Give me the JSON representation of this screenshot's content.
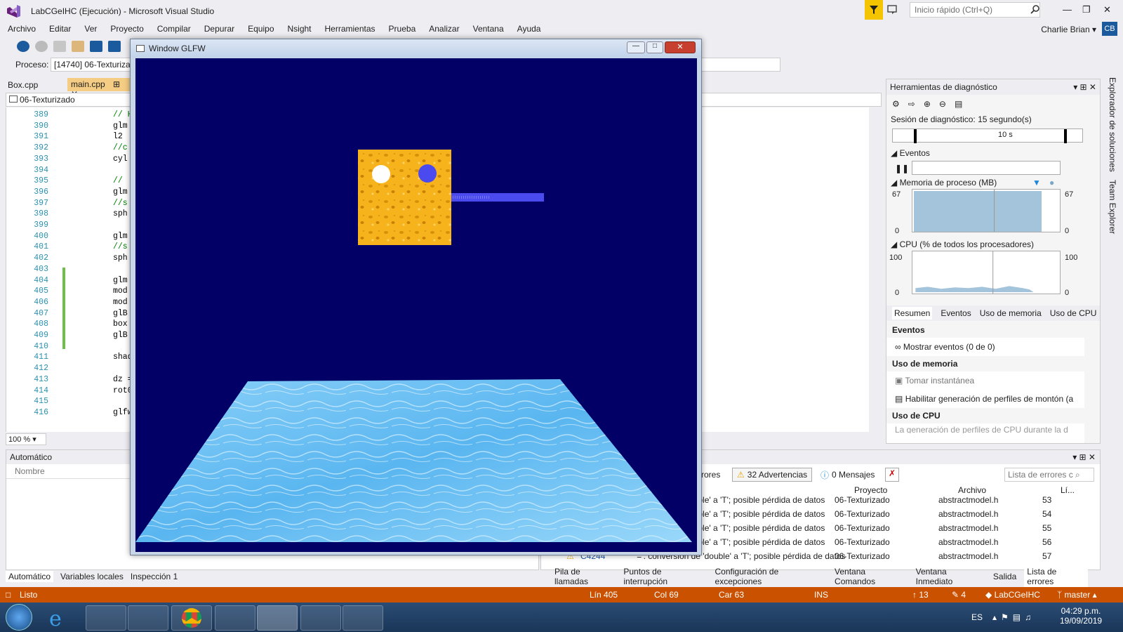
{
  "window": {
    "title": "LabCGeIHC (Ejecución) - Microsoft Visual Studio",
    "quick_launch_placeholder": "Inicio rápido (Ctrl+Q)"
  },
  "user": {
    "name": "Charlie Brian",
    "initials": "CB"
  },
  "menu": [
    "Archivo",
    "Editar",
    "Ver",
    "Proyecto",
    "Compilar",
    "Depurar",
    "Equipo",
    "Nsight",
    "Herramientas",
    "Prueba",
    "Analizar",
    "Ventana",
    "Ayuda"
  ],
  "toolbar": {
    "process_label": "Proceso:",
    "process_value": "[14740] 06-Texturiza"
  },
  "tabs": [
    {
      "label": "Box.cpp"
    },
    {
      "label": "main.cpp"
    }
  ],
  "editor": {
    "nav": "06-Texturizado",
    "zoom": "100 %",
    "lines": [
      {
        "n": "389",
        "t": "// H",
        "c": true
      },
      {
        "n": "390",
        "t": "glm"
      },
      {
        "n": "391",
        "t": "l2"
      },
      {
        "n": "392",
        "t": "//c",
        "c": true
      },
      {
        "n": "393",
        "t": "cyl"
      },
      {
        "n": "394",
        "t": ""
      },
      {
        "n": "395",
        "t": "//",
        "c": true
      },
      {
        "n": "396",
        "t": "glm"
      },
      {
        "n": "397",
        "t": "//s",
        "c": true
      },
      {
        "n": "398",
        "t": "sph"
      },
      {
        "n": "399",
        "t": ""
      },
      {
        "n": "400",
        "t": "glm"
      },
      {
        "n": "401",
        "t": "//s",
        "c": true
      },
      {
        "n": "402",
        "t": "sph"
      },
      {
        "n": "403",
        "t": ""
      },
      {
        "n": "404",
        "t": "glm"
      },
      {
        "n": "405",
        "t": "mod"
      },
      {
        "n": "406",
        "t": "mod"
      },
      {
        "n": "407",
        "t": "glB"
      },
      {
        "n": "408",
        "t": "box"
      },
      {
        "n": "409",
        "t": "glB"
      },
      {
        "n": "410",
        "t": ""
      },
      {
        "n": "411",
        "t": "shad"
      },
      {
        "n": "412",
        "t": ""
      },
      {
        "n": "413",
        "t": "dz ="
      },
      {
        "n": "414",
        "t": "rot0"
      },
      {
        "n": "415",
        "t": ""
      },
      {
        "n": "416",
        "t": "glfw"
      }
    ]
  },
  "glfw": {
    "title": "Window GLFW"
  },
  "diagnostics": {
    "title": "Herramientas de diagnóstico",
    "session": "Sesión de diagnóstico: 15 segundo(s)",
    "timeline_label": "10 s",
    "events_label": "Eventos",
    "memory_label": "Memoria de proceso (MB)",
    "memory_max": "67",
    "memory_min": "0",
    "cpu_label": "CPU (% de todos los procesadores)",
    "cpu_max": "100",
    "cpu_min": "0",
    "tabs": [
      "Resumen",
      "Eventos",
      "Uso de memoria",
      "Uso de CPU"
    ],
    "summary": {
      "events_header": "Eventos",
      "show_events": "Mostrar eventos (0 de 0)",
      "memory_header": "Uso de memoria",
      "snapshot": "Tomar instantánea",
      "heap_profiling": "Habilitar generación de perfiles de montón (a",
      "cpu_header": "Uso de CPU",
      "cpu_note": "La generación de perfiles de CPU durante la d"
    }
  },
  "auto_pane": {
    "title": "Automático",
    "col_name": "Nombre",
    "tabs": [
      "Automático",
      "Variables locales",
      "Inspección 1"
    ]
  },
  "errors_pane": {
    "errors_btn": "rores",
    "warnings_btn": "32 Advertencias",
    "messages_btn": "0 Mensajes",
    "search_placeholder": "Lista de errores c",
    "cols": {
      "project": "Proyecto",
      "file": "Archivo",
      "line": "Lí..."
    },
    "rows": [
      {
        "desc": "ouble' a 'T'; posible pérdida de datos",
        "project": "06-Texturizado",
        "file": "abstractmodel.h",
        "line": "53"
      },
      {
        "desc": "ouble' a 'T'; posible pérdida de datos",
        "project": "06-Texturizado",
        "file": "abstractmodel.h",
        "line": "54"
      },
      {
        "desc": "ouble' a 'T'; posible pérdida de datos",
        "project": "06-Texturizado",
        "file": "abstractmodel.h",
        "line": "55"
      },
      {
        "desc": "ouble' a 'T'; posible pérdida de datos",
        "project": "06-Texturizado",
        "file": "abstractmodel.h",
        "line": "56"
      },
      {
        "code": "C4244",
        "desc": "'=': conversión de 'double' a 'T'; posible pérdida de datos",
        "project": "06-Texturizado",
        "file": "abstractmodel.h",
        "line": "57"
      }
    ],
    "tabs": [
      "Pila de llamadas",
      "Puntos de interrupción",
      "Configuración de excepciones",
      "Ventana Comandos",
      "Ventana Inmediato",
      "Salida",
      "Lista de errores"
    ]
  },
  "status": {
    "ready": "Listo",
    "line": "Lín 405",
    "col": "Col 69",
    "car": "Car 63",
    "ins": "INS",
    "up": "13",
    "edits": "4",
    "repo": "LabCGeIHC",
    "branch": "master"
  },
  "taskbar": {
    "lang": "ES",
    "time": "04:29 p.m.",
    "date": "19/09/2019"
  },
  "side_tabs": [
    "Explorador de soluciones",
    "Team Explorer"
  ],
  "colors": {
    "accent": "#ca5100",
    "vs_purple": "#68217a",
    "glfw_bg": "#020066",
    "sphere_blue": "#4a4aef"
  }
}
